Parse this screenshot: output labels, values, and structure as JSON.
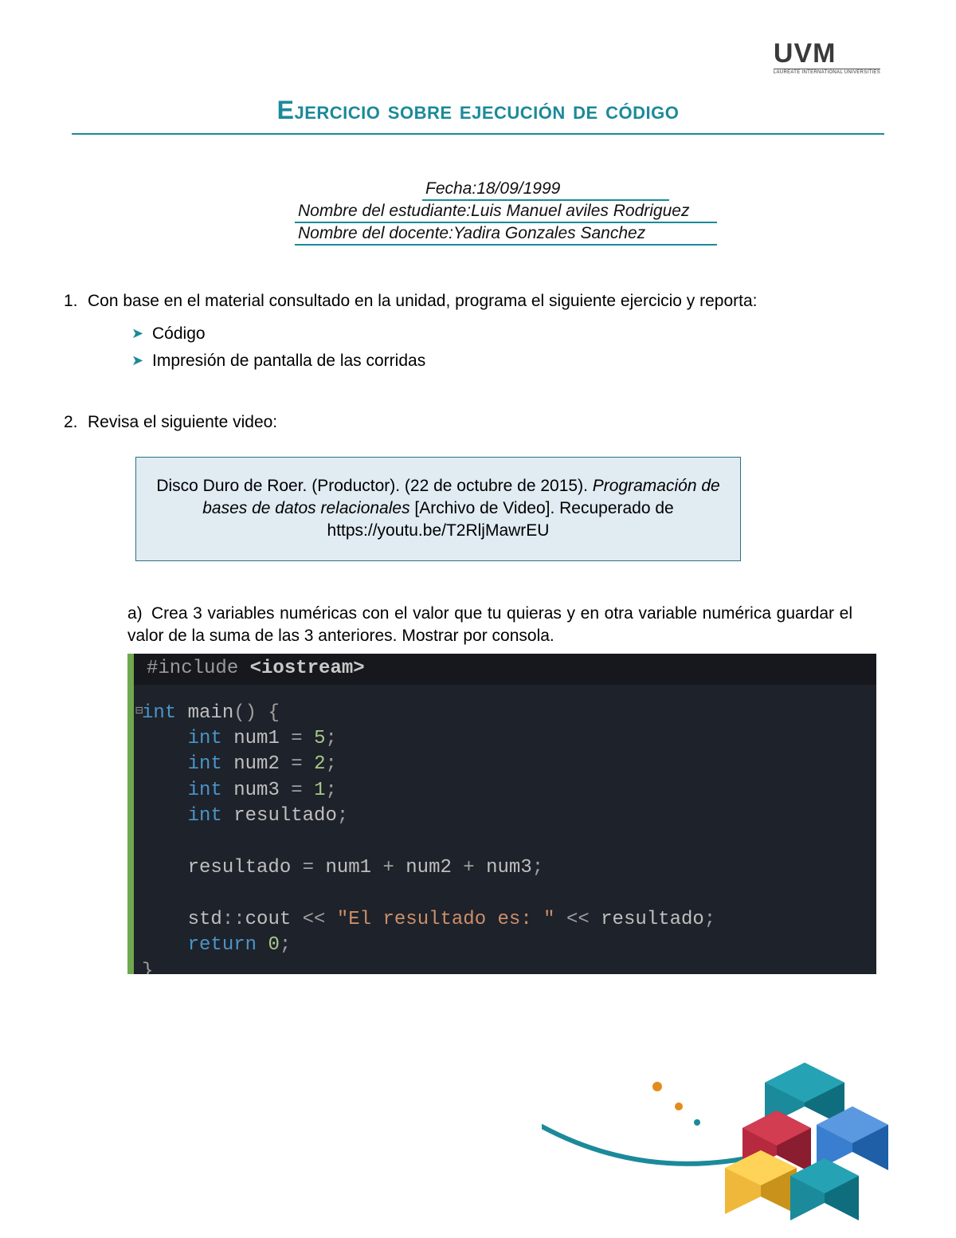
{
  "logo": {
    "text": "UVM",
    "subtitle": "LAUREATE INTERNATIONAL UNIVERSITIES"
  },
  "title": "Ejercicio sobre ejecución de código",
  "meta": {
    "line1": "Fecha:18/09/1999",
    "line2": "Nombre del estudiante:Luis Manuel aviles Rodriguez",
    "line3": "Nombre del docente:Yadira Gonzales Sanchez"
  },
  "q1": {
    "number": "1.",
    "text": "Con base en el material consultado en la unidad, programa el siguiente ejercicio y reporta:",
    "bullets": [
      "Código",
      "Impresión de pantalla de las corridas"
    ]
  },
  "q2": {
    "number": "2.",
    "text": "Revisa el siguiente video:"
  },
  "citation": {
    "author": "Disco Duro de Roer. (Productor). (22 de octubre de 2015). ",
    "title_italic": "Programación de bases de datos relacionales",
    "rest": " [Archivo de Video]. Recuperado de https://youtu.be/T2RljMawrEU"
  },
  "subA": {
    "label": "a)",
    "text": "Crea 3 variables numéricas con el valor que tu quieras y en otra variable numérica guardar el valor de la suma de las 3 anteriores. Mostrar por consola."
  },
  "code": {
    "include_directive": "#include",
    "include_lib": "<iostream>",
    "tokens": {
      "int": "int",
      "main": "main",
      "num1": "num1",
      "num2": "num2",
      "num3": "num3",
      "resultado": "resultado",
      "v1": "5",
      "v2": "2",
      "v3": "1",
      "zero": "0",
      "std": "std",
      "cout": "cout",
      "return": "return",
      "stringlit": "\"El resultado es: \""
    }
  }
}
